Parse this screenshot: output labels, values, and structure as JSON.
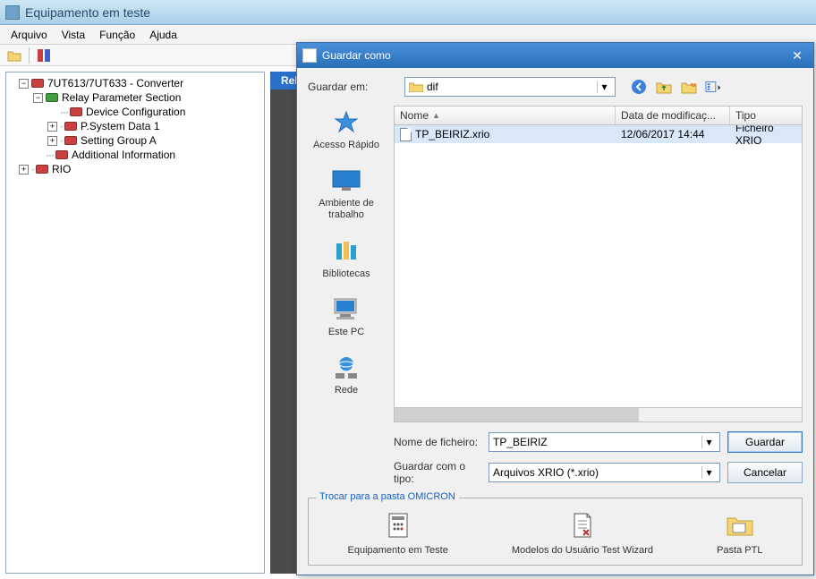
{
  "main": {
    "title": "Equipamento em teste",
    "menu": {
      "arquivo": "Arquivo",
      "vista": "Vista",
      "funcao": "Função",
      "ajuda": "Ajuda"
    }
  },
  "tree": {
    "root": "7UT613/7UT633 - Converter",
    "relay_section": "Relay Parameter Section",
    "device_config": "Device Configuration",
    "psystem": "P.System Data 1",
    "setting_group": "Setting Group A",
    "additional": "Additional Information",
    "rio": "RIO"
  },
  "right_panel": {
    "tab": "Relay"
  },
  "dialog": {
    "title": "Guardar como",
    "save_in_label": "Guardar em:",
    "folder": "dif",
    "columns": {
      "name": "Nome",
      "date": "Data de modificaç...",
      "type": "Tipo"
    },
    "files": [
      {
        "name": "TP_BEIRIZ.xrio",
        "date": "12/06/2017 14:44",
        "type": "Ficheiro XRIO"
      }
    ],
    "places": {
      "quick": "Acesso Rápido",
      "desktop": "Ambiente de trabalho",
      "libraries": "Bibliotecas",
      "thispc": "Este PC",
      "network": "Rede"
    },
    "filename_label": "Nome de ficheiro:",
    "filename_value": "TP_BEIRIZ",
    "filetype_label": "Guardar com o tipo:",
    "filetype_value": "Arquivos XRIO (*.xrio)",
    "save_btn": "Guardar",
    "cancel_btn": "Cancelar",
    "group_legend": "Trocar para a pasta OMICRON",
    "shortcuts": {
      "equip": "Equipamento em Teste",
      "models": "Modelos do Usuário Test Wizard",
      "ptl": "Pasta PTL"
    }
  }
}
